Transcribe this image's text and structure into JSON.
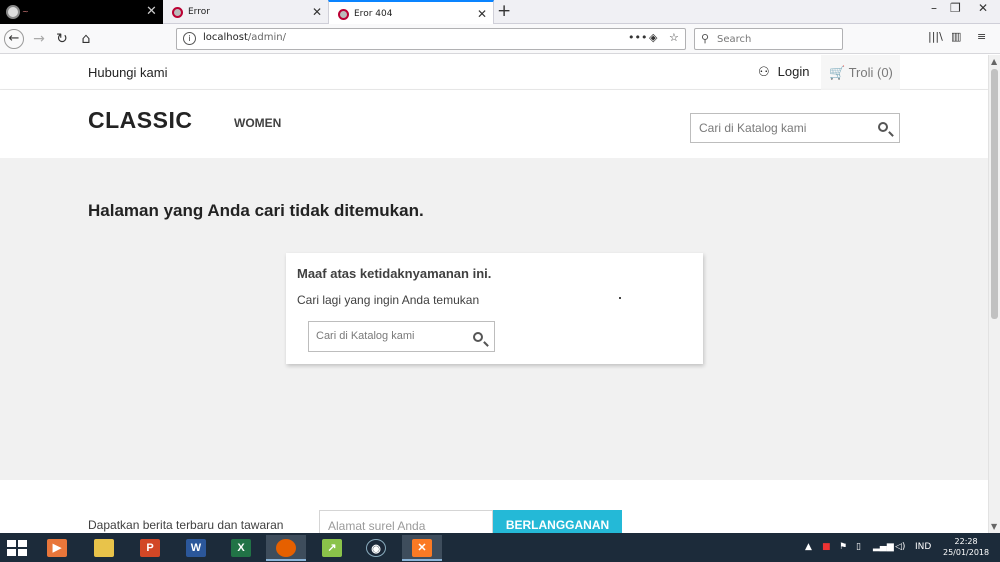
{
  "browser": {
    "tabs": [
      {
        "title": "Error"
      },
      {
        "title": "Eror 404",
        "active": true
      }
    ],
    "url_host": "localhost",
    "url_path": "/admin/",
    "search_placeholder": "Search",
    "window_buttons": [
      "–",
      "❐",
      "✕"
    ]
  },
  "site": {
    "topbar": {
      "contact": "Hubungi kami",
      "login": "Login",
      "cart": "Troli (0)"
    },
    "header": {
      "logo": "CLASSIC",
      "menu": [
        "WOMEN"
      ],
      "search_placeholder": "Cari di Katalog kami"
    },
    "error": {
      "title": "Halaman yang Anda cari tidak ditemukan.",
      "card_heading": "Maaf atas ketidaknyamanan ini.",
      "card_text": "Cari lagi yang ingin Anda temukan",
      "search_placeholder": "Cari di Katalog kami"
    },
    "newsletter": {
      "text": "Dapatkan berita terbaru dan tawaran",
      "placeholder": "Alamat surel Anda",
      "button": "BERLANGGANAN"
    }
  },
  "taskbar": {
    "language": "IND",
    "time": "22:28",
    "date": "25/01/2018"
  },
  "colors": {
    "accent": "#24b9d7",
    "page_bg": "#f1f1f1",
    "taskbar": "#1c2b3a"
  }
}
